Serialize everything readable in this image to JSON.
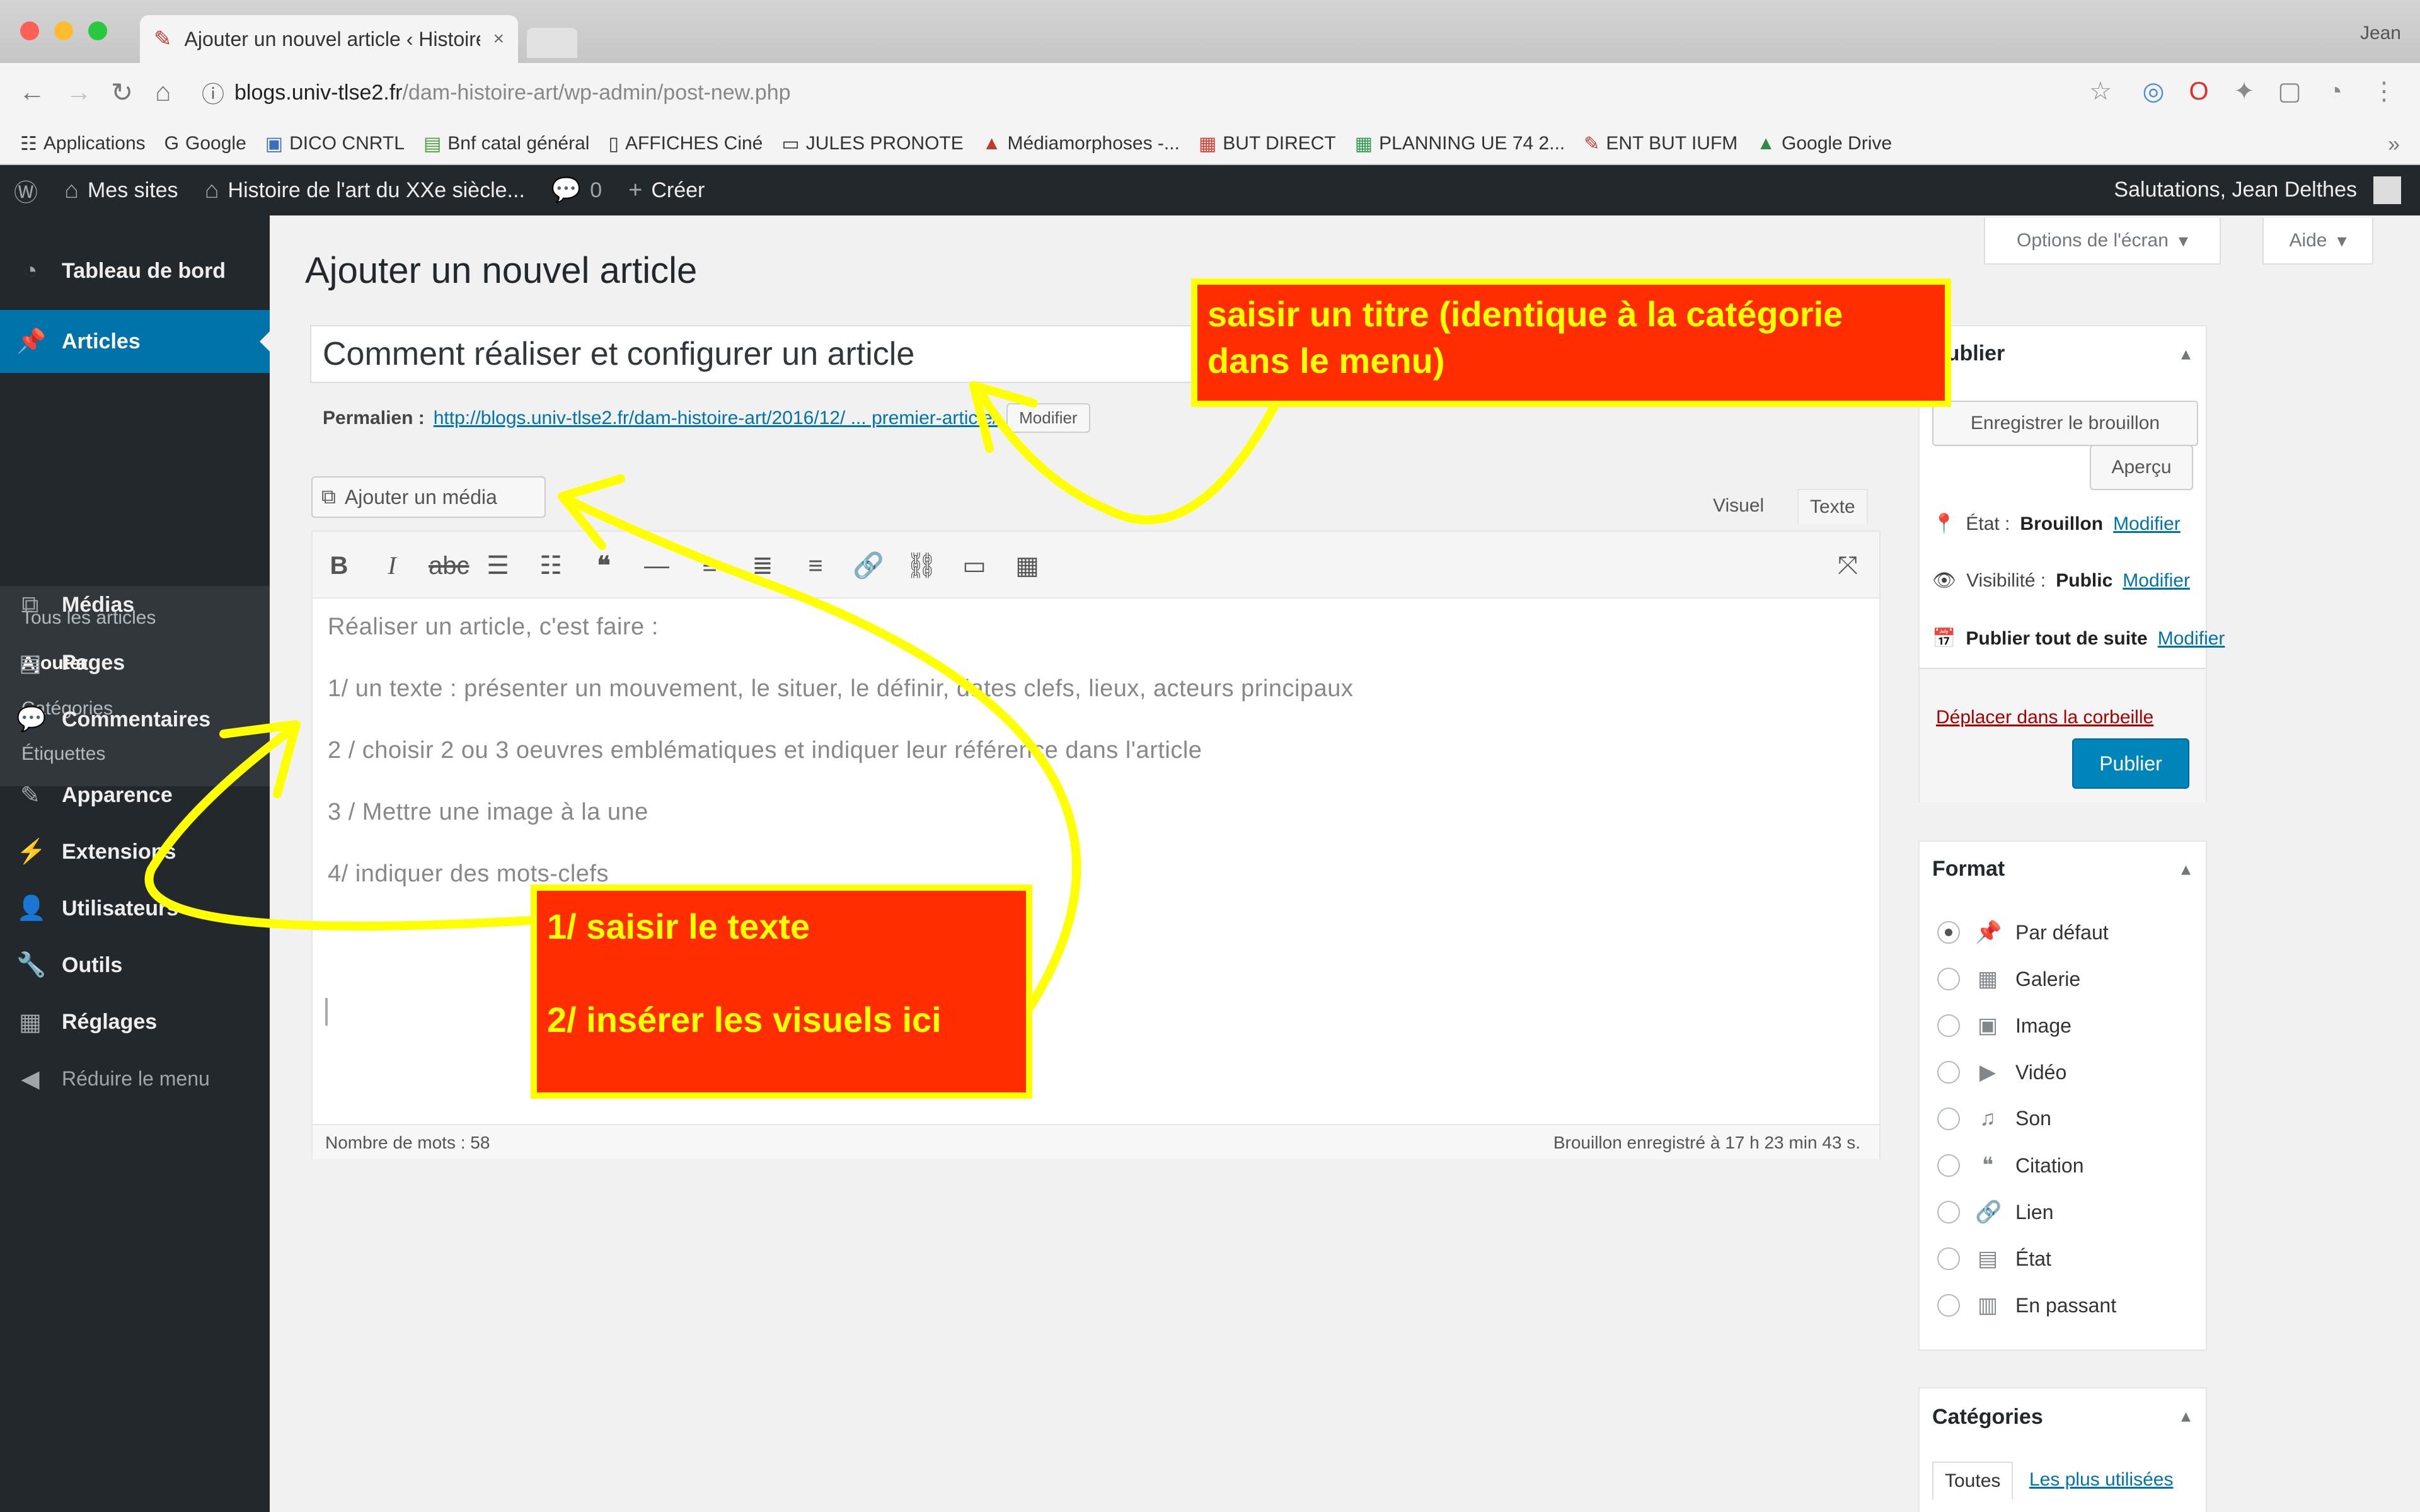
{
  "browser": {
    "tab_title": "Ajouter un nouvel article ‹ Histoire",
    "close_glyph": "×",
    "user_name": "Jean",
    "url_host": "blogs.univ-tlse2.fr",
    "url_path": "/dam-histoire-art/wp-admin/post-new.php",
    "bookmarks": [
      {
        "icon": "☷",
        "label": "Applications"
      },
      {
        "icon": "G",
        "label": "Google"
      },
      {
        "icon": "▣",
        "label": "DICO CNRTL"
      },
      {
        "icon": "▤",
        "label": "Bnf catal général"
      },
      {
        "icon": "▯",
        "label": "AFFICHES Ciné"
      },
      {
        "icon": "▭",
        "label": "JULES PRONOTE"
      },
      {
        "icon": "▲",
        "label": "Médiamorphoses -..."
      },
      {
        "icon": "▦",
        "label": "BUT DIRECT"
      },
      {
        "icon": "▦",
        "label": "PLANNING UE 74 2..."
      },
      {
        "icon": "✎",
        "label": "ENT BUT IUFM"
      },
      {
        "icon": "▲",
        "label": "Google Drive"
      }
    ]
  },
  "adminbar": {
    "my_sites": "Mes sites",
    "site_name": "Histoire de l'art du XXe siècle...",
    "comments_count": "0",
    "new_label": "Créer",
    "greeting": "Salutations, Jean Delthes"
  },
  "sidebar": {
    "dashboard": "Tableau de bord",
    "articles": "Articles",
    "sub_all": "Tous les articles",
    "sub_add": "Ajouter",
    "sub_categories": "Catégories",
    "sub_tags": "Étiquettes",
    "media": "Médias",
    "pages": "Pages",
    "comments": "Commentaires",
    "appearance": "Apparence",
    "plugins": "Extensions",
    "users": "Utilisateurs",
    "tools": "Outils",
    "settings": "Réglages",
    "collapse": "Réduire le menu"
  },
  "main": {
    "screen_options": "Options de l'écran",
    "help": "Aide",
    "page_title": "Ajouter un nouvel article",
    "post_title": "Comment réaliser et configurer un article",
    "permalink_label": "Permalien :",
    "permalink_url": "http://blogs.univ-tlse2.fr/dam-histoire-art/2016/12/ ... premier-article/",
    "permalink_edit": "Modifier",
    "add_media": "Ajouter un média",
    "tab_visual": "Visuel",
    "tab_text": "Texte",
    "content_lines": [
      "Réaliser un article, c'est faire :",
      "1/ un texte : présenter un mouvement, le situer, le définir, dates clefs, lieux, acteurs principaux",
      "2 / choisir 2 ou 3 oeuvres emblématiques et indiquer leur référence dans l'article",
      "3 / Mettre une image à la une",
      "4/ indiquer des mots-clefs"
    ],
    "word_count": "Nombre de mots : 58",
    "draft_saved": "Brouillon enregistré à 17 h 23 min 43 s."
  },
  "publish_box": {
    "title": "Publier",
    "save_draft": "Enregistrer le brouillon",
    "preview": "Aperçu",
    "status_label": "État :",
    "status_value": "Brouillon",
    "visibility_label": "Visibilité :",
    "visibility_value": "Public",
    "schedule_label": "Publier tout de suite",
    "edit_link": "Modifier",
    "trash": "Déplacer dans la corbeille",
    "publish": "Publier"
  },
  "format_box": {
    "title": "Format",
    "options": [
      {
        "icon": "📌",
        "label": "Par défaut",
        "checked": true
      },
      {
        "icon": "▦",
        "label": "Galerie",
        "checked": false
      },
      {
        "icon": "▣",
        "label": "Image",
        "checked": false
      },
      {
        "icon": "▶",
        "label": "Vidéo",
        "checked": false
      },
      {
        "icon": "♫",
        "label": "Son",
        "checked": false
      },
      {
        "icon": "❝",
        "label": "Citation",
        "checked": false
      },
      {
        "icon": "🔗",
        "label": "Lien",
        "checked": false
      },
      {
        "icon": "▤",
        "label": "État",
        "checked": false
      },
      {
        "icon": "▥",
        "label": "En passant",
        "checked": false
      }
    ]
  },
  "categories_box": {
    "title": "Catégories",
    "tab_all": "Toutes",
    "tab_most_used": "Les plus utilisées"
  },
  "annotations": {
    "title_note_line1": "saisir un titre (identique à la catégorie",
    "title_note_line2": "dans le menu)",
    "content_note_line1": "1/ saisir le texte",
    "content_note_line2": "2/ insérer les visuels ici"
  },
  "colors": {
    "admin_dark": "#23282d",
    "wp_blue": "#0073aa",
    "callout_bg": "#ff2d00",
    "callout_text": "#ffff00"
  }
}
